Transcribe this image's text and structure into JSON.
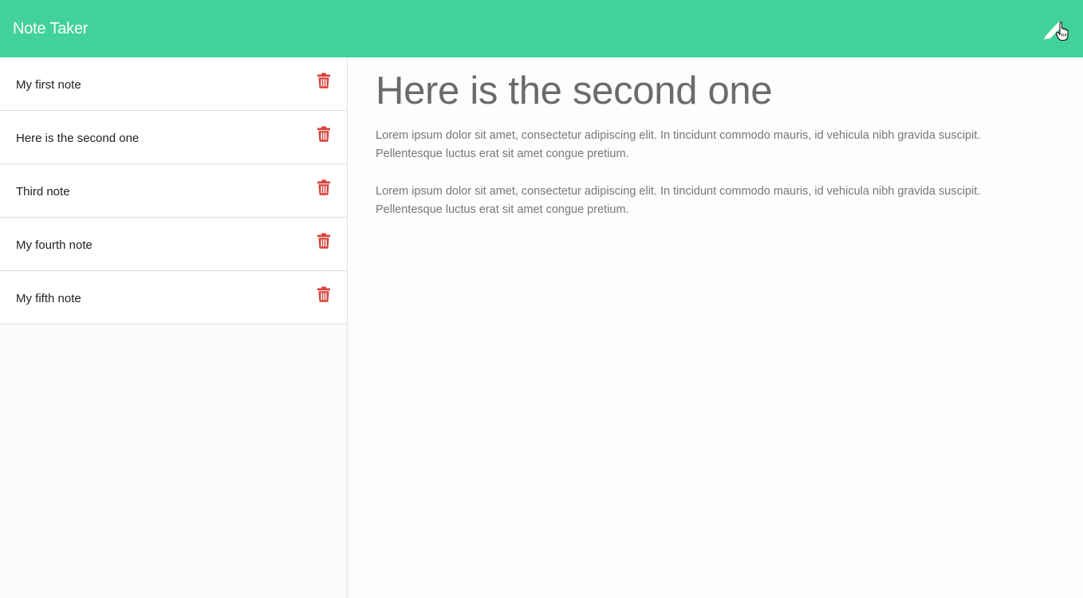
{
  "app": {
    "title": "Note Taker"
  },
  "notes": [
    {
      "title": "My first note"
    },
    {
      "title": "Here is the second one"
    },
    {
      "title": "Third note"
    },
    {
      "title": "My fourth note"
    },
    {
      "title": "My fifth note"
    }
  ],
  "active_note": {
    "title": "Here is the second one",
    "paragraphs": [
      "Lorem ipsum dolor sit amet, consectetur adipiscing elit. In tincidunt commodo mauris, id vehicula nibh gravida suscipit. Pellentesque luctus erat sit amet congue pretium.",
      "Lorem ipsum dolor sit amet, consectetur adipiscing elit. In tincidunt commodo mauris, id vehicula nibh gravida suscipit. Pellentesque luctus erat sit amet congue pretium."
    ]
  },
  "icons": {
    "new_note": "pen-icon",
    "delete": "trash-icon"
  },
  "colors": {
    "navbar": "#42d19b",
    "delete_icon": "#d9423c",
    "heading": "#6b6b6b",
    "body_text": "#777777"
  }
}
